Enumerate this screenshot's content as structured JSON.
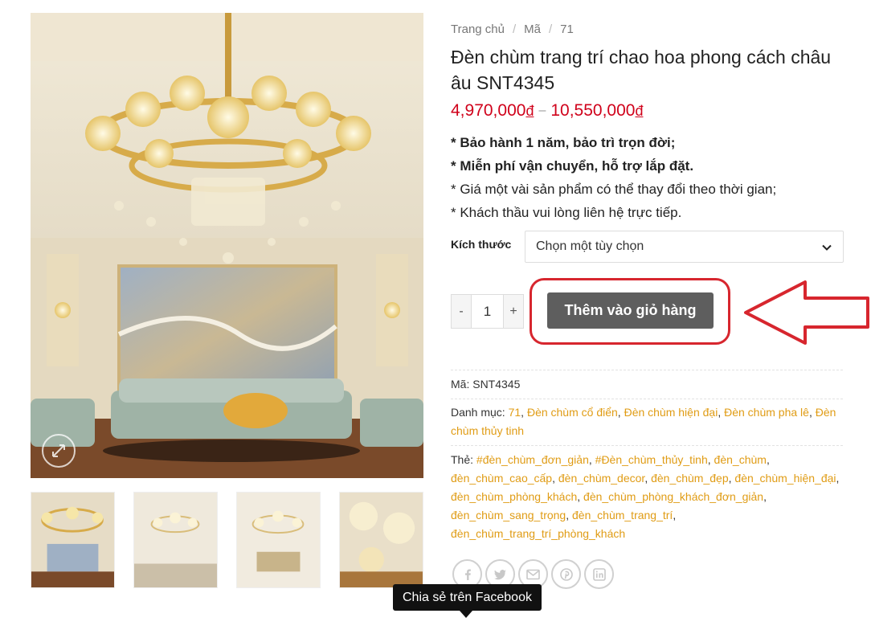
{
  "breadcrumb": {
    "home": "Trang chủ",
    "category": "Mã",
    "current": "71",
    "separator": "/"
  },
  "product": {
    "title": "Đèn chùm trang trí chao hoa phong cách châu âu SNT4345",
    "price_min": "4,970,000",
    "price_max": "10,550,000",
    "currency": "đ",
    "price_dash": "–",
    "features": [
      "* Bảo hành 1 năm, bảo trì trọn đời;",
      "* Miễn phí vận chuyển, hỗ trợ lắp đặt.",
      "* Giá một vài sản phẩm có thể thay đổi theo thời gian;",
      "* Khách thầu vui lòng liên hệ trực tiếp."
    ]
  },
  "variation": {
    "label": "Kích thước",
    "selected": "Chọn một tùy chọn"
  },
  "quantity": {
    "minus": "-",
    "value": "1",
    "plus": "+"
  },
  "add_to_cart": "Thêm vào giỏ hàng",
  "meta": {
    "sku_label": "Mã:",
    "sku": "SNT4345",
    "categories_label": "Danh mục:",
    "categories": [
      "71",
      "Đèn chùm cổ điển",
      "Đèn chùm hiện đại",
      "Đèn chùm pha lê",
      "Đèn chùm thủy tinh"
    ],
    "tags_label": "Thẻ:",
    "tags": [
      "#đèn_chùm_đơn_giản",
      "#Đèn_chùm_thủy_tinh",
      "đèn_chùm",
      "đèn_chùm_cao_cấp",
      "đèn_chùm_decor",
      "đèn_chùm_đẹp",
      "đèn_chùm_hiện_đại",
      "đèn_chùm_phòng_khách",
      "đèn_chùm_phòng_khách_đơn_giản",
      "đèn_chùm_sang_trọng",
      "đèn_chùm_trang_trí",
      "đèn_chùm_trang_trí_phòng_khách"
    ]
  },
  "share": {
    "icons": [
      "facebook-icon",
      "twitter-icon",
      "email-icon",
      "pinterest-icon",
      "linkedin-icon"
    ],
    "tooltip": "Chia sẻ trên Facebook"
  },
  "colors": {
    "price": "#d0021b",
    "link": "#e09c15",
    "button": "#5e5e5e",
    "annotation": "#d7262e"
  }
}
